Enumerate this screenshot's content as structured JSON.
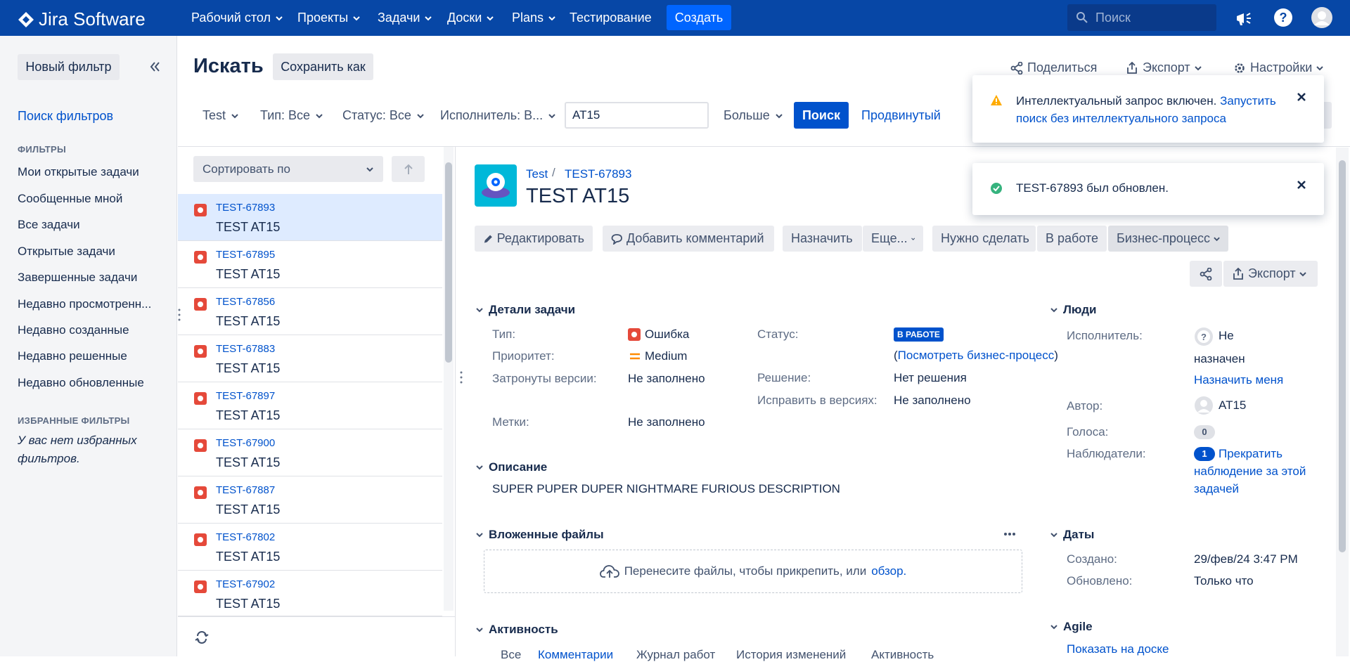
{
  "topnav": {
    "logo_text": "Jira Software",
    "items": [
      "Рабочий стол",
      "Проекты",
      "Задачи",
      "Доски",
      "Plans"
    ],
    "testing": "Тестирование",
    "create_label": "Создать",
    "search_placeholder": "Поиск"
  },
  "sidebar": {
    "new_filter": "Новый фильтр",
    "find_filters": "Поиск фильтров",
    "filters_heading": "ФИЛЬТРЫ",
    "filters": [
      "Мои открытые задачи",
      "Сообщенные мной",
      "Все задачи",
      "Открытые задачи",
      "Завершенные задачи",
      "Недавно просмотренн...",
      "Недавно созданные",
      "Недавно решенные",
      "Недавно обновленные"
    ],
    "fav_heading": "ИЗБРАННЫЕ ФИЛЬТРЫ",
    "fav_empty": "У вас нет избранных фильтров."
  },
  "header": {
    "title": "Искать",
    "save_as": "Сохранить как",
    "share": "Поделиться",
    "export": "Экспорт",
    "settings": "Настройки"
  },
  "filters": {
    "project": "Test",
    "type": "Тип: Все",
    "status": "Статус: Все",
    "assignee": "Исполнитель: В...",
    "query": "AT15",
    "more": "Больше",
    "search": "Поиск",
    "advanced": "Продвинутый"
  },
  "list": {
    "sort": "Сортировать по",
    "issues": [
      {
        "key": "TEST-67893",
        "summary": "TEST AT15"
      },
      {
        "key": "TEST-67895",
        "summary": "TEST AT15"
      },
      {
        "key": "TEST-67856",
        "summary": "TEST AT15"
      },
      {
        "key": "TEST-67883",
        "summary": "TEST AT15"
      },
      {
        "key": "TEST-67897",
        "summary": "TEST AT15"
      },
      {
        "key": "TEST-67900",
        "summary": "TEST AT15"
      },
      {
        "key": "TEST-67887",
        "summary": "TEST AT15"
      },
      {
        "key": "TEST-67802",
        "summary": "TEST AT15"
      },
      {
        "key": "TEST-67902",
        "summary": "TEST AT15"
      }
    ]
  },
  "issue": {
    "project": "Test",
    "key": "TEST-67893",
    "title": "TEST AT15",
    "buttons": {
      "edit": "Редактировать",
      "comment": "Добавить комментарий",
      "assign": "Назначить",
      "more": "Еще...",
      "todo": "Нужно сделать",
      "inprogress": "В работе",
      "workflow": "Бизнес-процесс",
      "export": "Экспорт"
    },
    "details": {
      "heading": "Детали задачи",
      "type_label": "Тип:",
      "type_value": "Ошибка",
      "priority_label": "Приоритет:",
      "priority_value": "Medium",
      "affects_label": "Затронуты версии:",
      "affects_value": "Не заполнено",
      "labels_label": "Метки:",
      "labels_value": "Не заполнено",
      "status_label": "Статус:",
      "status_value": "В РАБОТЕ",
      "workflow_link": "Посмотреть бизнес-процесс",
      "resolution_label": "Решение:",
      "resolution_value": "Нет решения",
      "fix_label": "Исправить в версиях:",
      "fix_value": "Не заполнено"
    },
    "description_heading": "Описание",
    "description": "SUPER PUPER DUPER NIGHTMARE FURIOUS DESCRIPTION",
    "attachments_heading": "Вложенные файлы",
    "drop_text": "Перенесите файлы, чтобы прикрепить, или",
    "browse": "обзор.",
    "activity_heading": "Активность",
    "activity_tabs": [
      "Все",
      "Комментарии",
      "Журнал работ",
      "История изменений",
      "Активность"
    ],
    "people": {
      "heading": "Люди",
      "assignee_label": "Исполнитель:",
      "assignee_l1": "Не",
      "assignee_l2": "назначен",
      "assign_me": "Назначить меня",
      "reporter_label": "Автор:",
      "reporter": "AT15",
      "votes_label": "Голоса:",
      "votes": "0",
      "watchers_label": "Наблюдатели:",
      "watchers": "1",
      "stop_watching_1": "Прекратить",
      "stop_watching_2": "наблюдение за этой",
      "stop_watching_3": "задачей"
    },
    "dates": {
      "heading": "Даты",
      "created_label": "Создано:",
      "created": "29/фев/24 3:47 PM",
      "updated_label": "Обновлено:",
      "updated": "Только что"
    },
    "agile": {
      "heading": "Agile",
      "show_board": "Показать на доске"
    }
  },
  "toasts": {
    "warning_text": "Интеллектуальный запрос включен.",
    "warning_link_1": "Запустить",
    "warning_link_2": "поиск без интеллектуального запроса",
    "success_text": "TEST-67893 был обновлен."
  },
  "colors": {
    "nav": "#0747a6",
    "primary": "#0052cc",
    "bug": "#e5493a",
    "status": "#0052cc",
    "success": "#36b37e",
    "warning": "#ffab00"
  }
}
